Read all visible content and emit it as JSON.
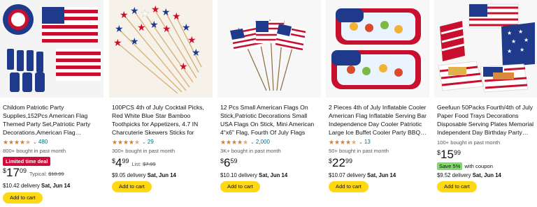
{
  "colors": {
    "star": "#de7921",
    "link": "#007185",
    "deal": "#cc0c39",
    "cart": "#ffd814",
    "coupon": "#7fda69"
  },
  "products": [
    {
      "title": "Childom Patriotic Party Supplies,152Pcs American Flag Themed Party Set,Patriotic Party Decorations,American Flag…",
      "rating": 4.5,
      "rating_icon": "star-icon",
      "review_count": "480",
      "bought": "800+ bought in past month",
      "deal_badge": "Limited time deal",
      "price_symbol": "$",
      "price_whole": "17",
      "price_fraction": "09",
      "price_extra_label": "Typical: ",
      "price_extra_value": "$18.99",
      "delivery_prefix": "$10.42 delivery ",
      "delivery_date": "Sat, Jun 14",
      "cart_label": "Add to cart"
    },
    {
      "title": "100PCS 4th of July Cocktail Picks, Red White Blue Star Bamboo Toothpicks for Appetizers, 4.7 IN Charcuterie Skewers Sticks for Four…",
      "rating": 4.5,
      "rating_icon": "star-icon",
      "review_count": "29",
      "bought": "300+ bought in past month",
      "price_symbol": "$",
      "price_whole": "4",
      "price_fraction": "99",
      "price_extra_label": "List: ",
      "price_extra_value": "$7.99",
      "delivery_prefix": "$9.05 delivery ",
      "delivery_date": "Sat, Jun 14",
      "cart_label": "Add to cart"
    },
    {
      "title": "12 Pcs Small American Flags On Stick,Patriotic Decorations Small USA Flags On Stick,  Mini American 4\"x6\" Flag, Fourth Of July Flags For…",
      "rating": 4.5,
      "rating_icon": "star-icon",
      "review_count": "2,000",
      "bought": "3K+ bought in past month",
      "price_symbol": "$",
      "price_whole": "6",
      "price_fraction": "59",
      "delivery_prefix": "$10.10 delivery ",
      "delivery_date": "Sat, Jun 14",
      "cart_label": "Add to cart"
    },
    {
      "title": "2 Pieces 4th of July Inflatable Cooler American Flag Inflatable Serving Bar Independence Day Cooler Patriotic Large Ice Buffet Cooler Party BBQ…",
      "rating": 4.5,
      "rating_icon": "star-icon",
      "review_count": "13",
      "bought": "50+ bought in past month",
      "price_symbol": "$",
      "price_whole": "22",
      "price_fraction": "99",
      "delivery_prefix": "$10.07 delivery ",
      "delivery_date": "Sat, Jun 14",
      "cart_label": "Add to cart"
    },
    {
      "title": "Geefuun 50Packs Fourth/4th of July Paper Food Trays Decorations Disposable Serving Plates Memorial Independent Day Birthday Party…",
      "bought": "100+ bought in past month",
      "price_symbol": "$",
      "price_whole": "15",
      "price_fraction": "99",
      "coupon_badge": "Save 5%",
      "coupon_text": "with coupon",
      "delivery_prefix": "$9.52 delivery ",
      "delivery_date": "Sat, Jun 14",
      "cart_label": "Add to cart"
    }
  ]
}
